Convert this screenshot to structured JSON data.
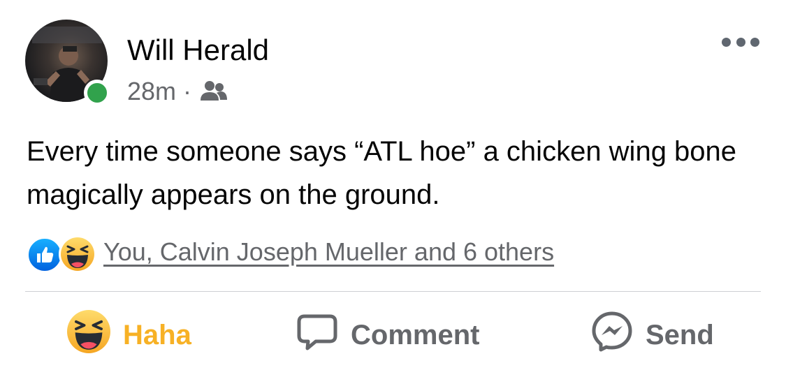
{
  "post": {
    "author": "Will Herald",
    "time": "28m",
    "separator": "·",
    "audience_icon": "friends-icon",
    "text": "Every time someone says “ATL hoe” a chicken wing bone magically appears on the ground.",
    "reactions_summary": "You, Calvin Joseph Mueller and 6 others",
    "reaction_types": [
      "like",
      "haha"
    ]
  },
  "actions": {
    "haha_label": "Haha",
    "comment_label": "Comment",
    "send_label": "Send"
  },
  "colors": {
    "online": "#31a24c",
    "haha_yellow": "#f7b125",
    "secondary_text": "#65676b",
    "like_blue": "#1877f2"
  }
}
